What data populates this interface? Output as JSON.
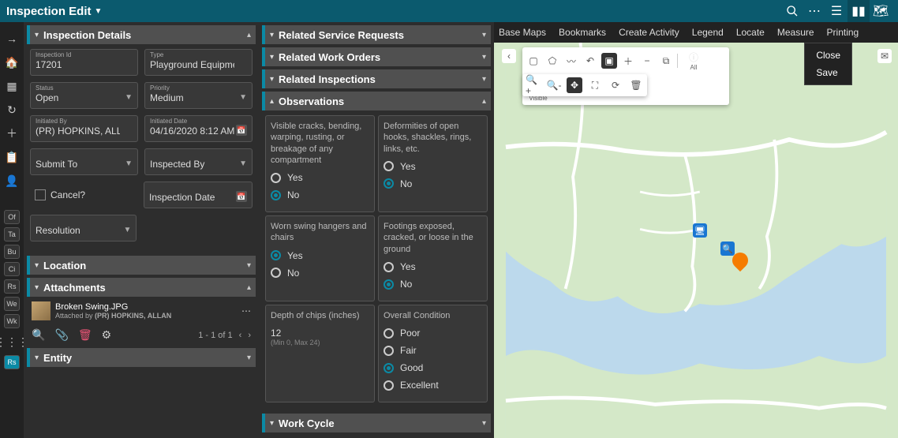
{
  "header": {
    "title": "Inspection Edit"
  },
  "leftnav_small": [
    "Of",
    "Ta",
    "Bu",
    "Ci",
    "Rs",
    "We",
    "Wk"
  ],
  "leftnav_active": "Rs2",
  "sections": {
    "details": "Inspection Details",
    "location": "Location",
    "attachments": "Attachments",
    "entity": "Entity",
    "rsr": "Related Service Requests",
    "rwo": "Related Work Orders",
    "ri": "Related Inspections",
    "obs": "Observations",
    "wc": "Work Cycle"
  },
  "details": {
    "inspection_id": {
      "label": "Inspection Id",
      "value": "17201"
    },
    "type": {
      "label": "Type",
      "value": "Playground Equipment"
    },
    "status": {
      "label": "Status",
      "value": "Open"
    },
    "priority": {
      "label": "Priority",
      "value": "Medium"
    },
    "initiated_by": {
      "label": "Initiated By",
      "value": "(PR) HOPKINS, ALLAN"
    },
    "initiated_date": {
      "label": "Initiated Date",
      "value": "04/16/2020 8:12 AM"
    },
    "submit_to": {
      "label": "Submit To",
      "value": ""
    },
    "inspected_by": {
      "label": "Inspected By",
      "value": ""
    },
    "cancel": {
      "label": "Cancel?"
    },
    "inspection_date": {
      "label": "Inspection Date",
      "value": ""
    },
    "resolution": {
      "label": "Resolution",
      "value": ""
    }
  },
  "attachment": {
    "name": "Broken Swing.JPG",
    "meta_prefix": "Attached by ",
    "meta": "(PR) HOPKINS, ALLAN",
    "pager": "1 - 1 of 1"
  },
  "observations": {
    "q1": {
      "text": "Visible cracks, bending, warping, rusting, or breakage of any compartment",
      "yes": "Yes",
      "no": "No",
      "sel": "No"
    },
    "q2": {
      "text": "Deformities of open hooks, shackles, rings, links, etc.",
      "yes": "Yes",
      "no": "No",
      "sel": "No"
    },
    "q3": {
      "text": "Worn swing hangers and chairs",
      "yes": "Yes",
      "no": "No",
      "sel": "Yes"
    },
    "q4": {
      "text": "Footings exposed, cracked, or loose in the ground",
      "yes": "Yes",
      "no": "No",
      "sel": "No"
    },
    "depth": {
      "label": "Depth of chips (inches)",
      "value": "12",
      "hint": "(Min 0, Max 24)"
    },
    "cond": {
      "label": "Overall Condition",
      "poor": "Poor",
      "fair": "Fair",
      "good": "Good",
      "excellent": "Excellent",
      "sel": "Good"
    }
  },
  "map": {
    "tabs": [
      "Base Maps",
      "Bookmarks",
      "Create Activity",
      "Legend",
      "Locate",
      "Measure",
      "Printing"
    ],
    "menu": {
      "close": "Close",
      "save": "Save"
    },
    "toollabels": {
      "all": "All",
      "top": "Top Visible"
    }
  }
}
